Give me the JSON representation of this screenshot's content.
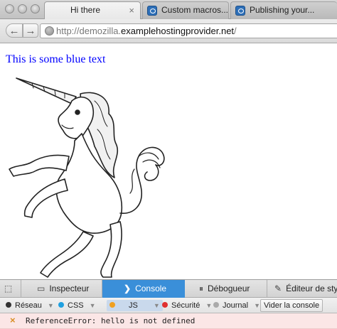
{
  "tabs": [
    {
      "label": "Hi there",
      "active": true,
      "favicon": "none",
      "close": "×"
    },
    {
      "label": "Custom macros...",
      "active": false,
      "favicon": "mdn-page-icon"
    },
    {
      "label": "Publishing your...",
      "active": false,
      "favicon": "mdn-page-icon"
    }
  ],
  "nav": {
    "back_icon": "←",
    "forward_icon": "→",
    "url_prefix": "http://demozilla.",
    "url_host": "examplehostingprovider.net",
    "url_suffix": "/"
  },
  "page": {
    "blue_text": "This is some blue text",
    "image": "rearing-unicorn-illustration"
  },
  "devtools": {
    "tabs": [
      {
        "label": "",
        "icon": "element-picker-icon"
      },
      {
        "label": "Inspecteur",
        "icon": "inspector-icon"
      },
      {
        "label": "Console",
        "icon": "console-icon",
        "selected": true
      },
      {
        "label": "Débogueur",
        "icon": "debugger-icon"
      },
      {
        "label": "Éditeur de style",
        "icon": "style-editor-icon"
      }
    ],
    "filters": [
      {
        "label": "Réseau",
        "color": "#333333"
      },
      {
        "label": "CSS",
        "color": "#1fa0e0"
      },
      {
        "label": "JS",
        "color": "#f0a020",
        "active": true
      },
      {
        "label": "Sécurité",
        "color": "#e03030"
      },
      {
        "label": "Journal",
        "color": "#aaaaaa"
      }
    ],
    "clear_label": "Vider la console",
    "messages": [
      {
        "icon": "×",
        "text": "ReferenceError: hello is not defined"
      }
    ]
  },
  "colors": {
    "console_accent": "#3a8fd9",
    "error_background": "#fbe6e6",
    "blue_text": "#0000ff"
  }
}
